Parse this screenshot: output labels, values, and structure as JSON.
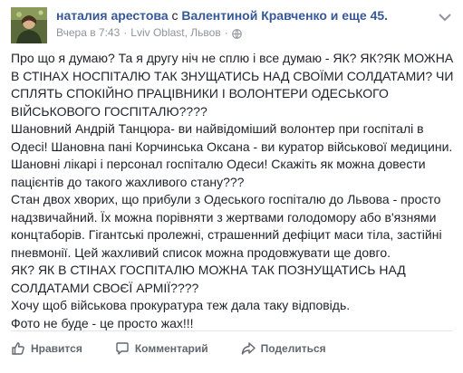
{
  "post": {
    "author": "наталия арестова",
    "with_prefix": "с",
    "tagged": "Валентиной Кравченко",
    "and_text": "и еще 45.",
    "timestamp": "Вчера в 7:43",
    "separator": "·",
    "location": "Lviv Oblast, Львов",
    "separator2": "·",
    "privacy_icon": "globe-icon",
    "more_icon": "chevron-down-icon",
    "paragraphs": [
      "Про що я думаю? Та я другу ніч не сплю і все думаю - ЯК? ЯК?ЯК МОЖНА В СТІНАХ НОСПІТАЛЮ ТАК ЗНУЩАТИСЬ НАД СВОЇМИ СОЛДАТАМИ? ЧИ СПЛЯТЬ СПОКІЙНО ПРАЦІВНИКИ І ВОЛОНТЕРИ ОДЕСЬКОГО ВІЙСЬКОВОГО ГОСПІТАЛЮ????",
      "Шановний Андрій Танцюра- ви найвідоміший волонтер при госпіталі в Одесі! Шановна пані Корчинська Оксана - ви куратор військової медицини. Шановні лікарі і персонал госпіталю Одеси! Скажіть як можна довести пацієнтів до такого жахливого стану???",
      "Стан двох хворих, що прибули з Одеського госпіталю до Львова - просто надзвичайний. Їх можна порівняти з жертвами голодомору або в'язнями концтаборів. Гігантські пролежні, страшенний дефіцит маси тіла, застійні пневмонії. Цей жахливий список можна продовжувати ще довго.",
      "ЯК? ЯК В СТІНАХ ГОСПІТАЛЮ МОЖНА ТАК ПОЗНУЩАТИСЬ НАД СОЛДАТАМИ СВОЄЇ АРМІЇ????",
      "Хочу щоб військова прокуратура теж дала таку відповідь.",
      "Фото не буде - це просто жах!!!"
    ]
  },
  "actions": {
    "like_label": "Нравится",
    "like_icon": "thumbs-up-icon",
    "comment_label": "Комментарий",
    "comment_icon": "comment-icon",
    "share_label": "Поделиться",
    "share_icon": "share-icon"
  },
  "colors": {
    "link": "#365899",
    "text": "#1d2129",
    "meta": "#90949c",
    "action": "#606770"
  }
}
